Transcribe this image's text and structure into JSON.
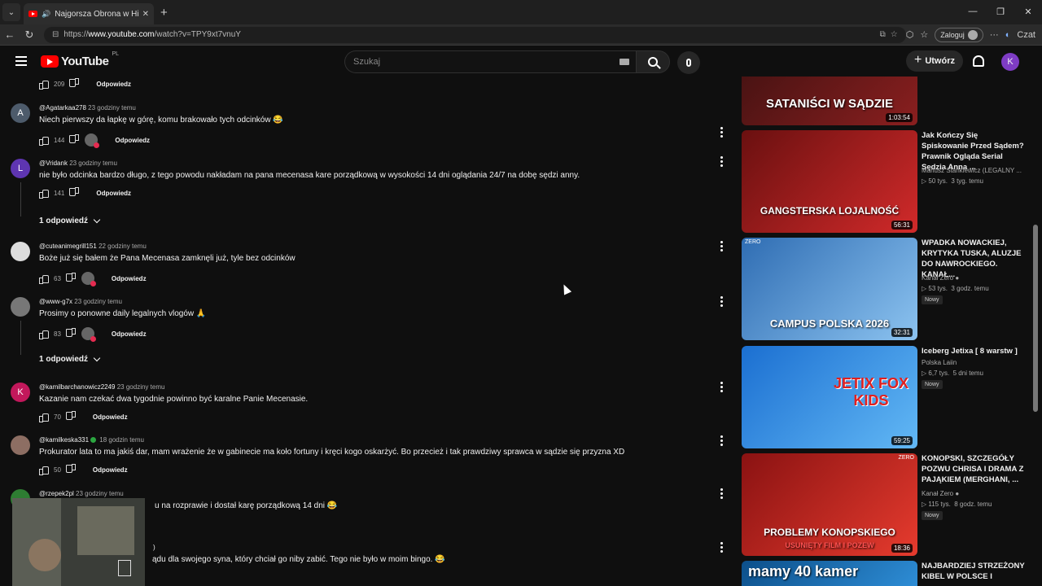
{
  "browser": {
    "tab_title": "Najgorsza Obrona w Historii",
    "url_prefix": "https://",
    "url_host": "www.youtube.com",
    "url_path": "/watch?v=TPY9xt7vnuY",
    "login_label": "Zaloguj",
    "chat_label": "Czat"
  },
  "header": {
    "logo_text": "YouTube",
    "region": "PL",
    "search_placeholder": "Szukaj",
    "create_label": "Utwórz",
    "user_initial": "K"
  },
  "comments": [
    {
      "likes": "209",
      "reply_label": "Odpowiedz"
    },
    {
      "avatar_letter": "A",
      "avatar_color": "#4d5b6b",
      "author": "@Agatarkaa278",
      "time": "23 godziny temu",
      "text": "Niech pierwszy da łapkę w górę, komu brakowało tych odcinków 😂",
      "likes": "144",
      "reply_label": "Odpowiedz"
    },
    {
      "avatar_letter": "L",
      "avatar_color": "#5e35b1",
      "author": "@Vridank",
      "time": "23 godziny temu",
      "text": "nie było odcinka bardzo długo, z tego powodu nakładam na pana mecenasa kare porządkową w wysokości  14 dni oglądania 24/7 na dobę sędzi anny.",
      "likes": "141",
      "reply_label": "Odpowiedz",
      "replies_label": "1 odpowiedź"
    },
    {
      "avatar_color": "#dddddd",
      "author": "@cuteanimegrill151",
      "time": "22 godziny temu",
      "text": "Boże już się bałem że Pana Mecenasa zamknęli już, tyle bez odcinków",
      "likes": "63",
      "reply_label": "Odpowiedz"
    },
    {
      "avatar_color": "#777777",
      "author": "@www-g7x",
      "time": "23 godziny temu",
      "text": "Prosimy o ponowne daily legalnych vlogów 🙏",
      "likes": "83",
      "reply_label": "Odpowiedz",
      "replies_label": "1 odpowiedź"
    },
    {
      "avatar_letter": "K",
      "avatar_color": "#c2185b",
      "author": "@kamilbarchanowicz2249",
      "time": "23 godziny temu",
      "text": "Kazanie nam czekać dwa tygodnie powinno być karalne Panie Mecenasie.",
      "likes": "70",
      "reply_label": "Odpowiedz"
    },
    {
      "avatar_color": "#8d6e63",
      "author": "@kamilkeska331",
      "time": "18 godzin temu",
      "text": "Prokurator lata to ma jakiś dar, mam wrażenie że w gabinecie ma koło fortuny i kręci kogo oskarżyć. Bo przecież i tak prawdziwy sprawca w sądzie się przyzna XD",
      "likes": "50",
      "reply_label": "Odpowiedz"
    },
    {
      "avatar_color": "#2e7d32",
      "author": "@rzepek2pl",
      "time": "23 godziny temu",
      "text": "u na rozprawie i dostał karę porządkową 14 dni 😂"
    },
    {
      "text": "ądu dla swojego syna, który chciał go niby zabić. Tego nie było w moim bingo. 😂",
      "author_partial": ")"
    }
  ],
  "videos": [
    {
      "caption": "SATANIŚCI W SĄDZIE",
      "duration": "1:03:54",
      "colors": [
        "#3a1010",
        "#8a1f1f"
      ]
    },
    {
      "caption": "GANGSTERSKA LOJALNOŚĆ",
      "duration": "56:31",
      "title": "Jak Kończy Się Spiskowanie Przed Sądem? Prawnik Ogląda Serial Sędzia Anna ...",
      "channel": "Mariusz Stankiewicz (LEGALNY ...",
      "views": "▷ 50 tys.",
      "age": "3 tyg. temu",
      "colors": [
        "#6a1010",
        "#d12a2a"
      ]
    },
    {
      "caption": "CAMPUS POLSKA 2026",
      "duration": "32:31",
      "title": "WPADKA NOWACKIEJ, KRYTYKA TUSKA, ALUZJE DO NAWROCKIEGO. KANAŁ...",
      "channel": "Kanał Zero",
      "views": "▷ 53 tys.",
      "age": "3 godz. temu",
      "badge": "Nowy",
      "corner": "ZERO",
      "colors": [
        "#2f6db3",
        "#8cc3f0"
      ]
    },
    {
      "caption": "JETIX FOX KIDS",
      "duration": "59:25",
      "title": "Iceberg Jetixa [ 8 warstw ]",
      "channel": "Polska Laiin",
      "views": "▷ 6,7 tys.",
      "age": "5 dni temu",
      "badge": "Nowy",
      "colors": [
        "#1b6fd1",
        "#62b8f5"
      ]
    },
    {
      "caption": "PROBLEMY KONOPSKIEGO",
      "subcaption": "USUNIĘTY FILM I POZEW",
      "duration": "18:36",
      "title": "KONOPSKI, SZCZEGÓŁY POZWU CHRISA I DRAMA Z PAJĄKIEM (MERGHANI, ...",
      "channel": "Kanał Zero",
      "views": "▷ 115 tys.",
      "age": "8 godz. temu",
      "badge": "Nowy",
      "corner": "ZERO",
      "colors": [
        "#8a1212",
        "#e63b2e"
      ]
    },
    {
      "caption": "mamy 40 kamer",
      "title": "NAJBARDZIEJ STRZEŻONY KIBEL W POLSCE I",
      "colors": [
        "#0c4f8a",
        "#2f8fd8"
      ]
    }
  ]
}
